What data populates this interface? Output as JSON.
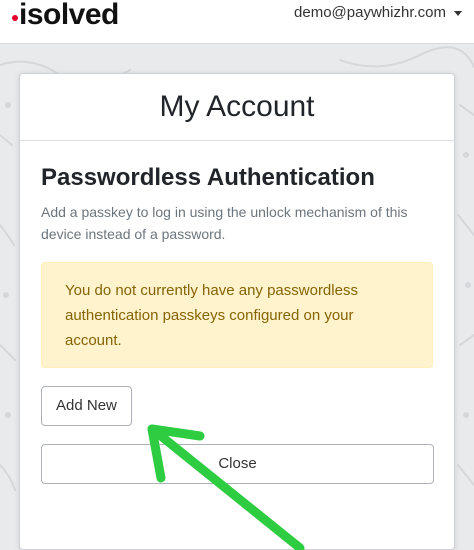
{
  "header": {
    "logo_text": "isolved",
    "user_email": "demo@paywhizhr.com"
  },
  "modal": {
    "title": "My Account",
    "section_title": "Passwordless Authentication",
    "description": "Add a passkey to log in using the unlock mechanism of this device instead of a password.",
    "alert_text": "You do not currently have any passwordless authentication passkeys configured on your account.",
    "add_new_label": "Add New",
    "close_label": "Close"
  },
  "annotation": {
    "arrow_color": "#2ecc40",
    "icon": "arrow-pointer-icon"
  },
  "colors": {
    "brand_dot": "#e4002b",
    "alert_bg": "#fff3cd",
    "alert_text": "#856404"
  }
}
